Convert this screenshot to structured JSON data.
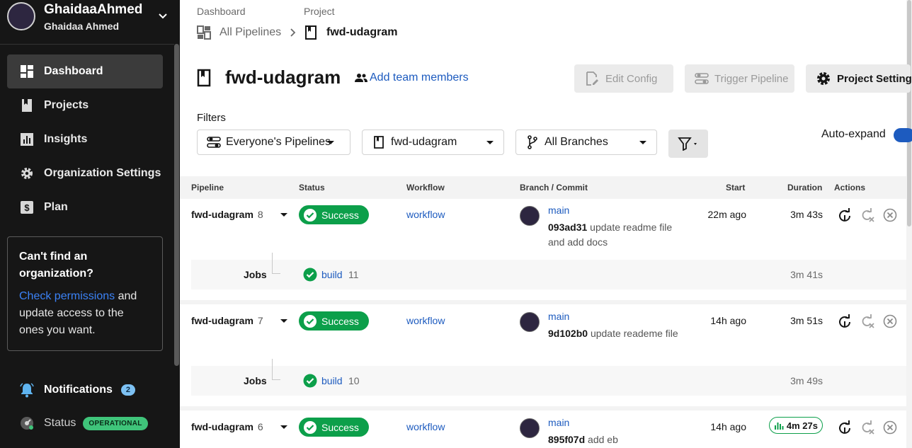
{
  "org": {
    "name": "GhaidaaAhmed",
    "user": "Ghaidaa Ahmed"
  },
  "nav": {
    "items": [
      {
        "label": "Dashboard",
        "icon": "dashboard-icon",
        "active": true
      },
      {
        "label": "Projects",
        "icon": "bookmark-icon",
        "active": false
      },
      {
        "label": "Insights",
        "icon": "bar-chart-icon",
        "active": false
      },
      {
        "label": "Organization Settings",
        "icon": "gear-icon",
        "active": false
      },
      {
        "label": "Plan",
        "icon": "dollar-icon",
        "active": false
      }
    ]
  },
  "card": {
    "heading": "Can't find an organization?",
    "link": "Check permissions",
    "text": " and update access to the ones you want."
  },
  "notifications": {
    "label": "Notifications",
    "count": "2"
  },
  "status": {
    "label": "Status",
    "badge": "OPERATIONAL"
  },
  "breadcrumb": {
    "dashboard_label": "Dashboard",
    "project_label": "Project",
    "pipelines": "All Pipelines",
    "project": "fwd-udagram"
  },
  "header": {
    "title": "fwd-udagram",
    "add_team": "Add team members",
    "edit_config": "Edit Config",
    "trigger": "Trigger Pipeline",
    "settings": "Project Settings"
  },
  "filters": {
    "label": "Filters",
    "everyone": "Everyone's Pipelines",
    "project": "fwd-udagram",
    "branches": "All Branches",
    "auto_expand": "Auto-expand"
  },
  "table": {
    "columns": {
      "pipeline": "Pipeline",
      "status": "Status",
      "workflow": "Workflow",
      "branch": "Branch / Commit",
      "start": "Start",
      "duration": "Duration",
      "actions": "Actions"
    },
    "rows": [
      {
        "name": "fwd-udagram",
        "number": "8",
        "status": "Success",
        "workflow": "workflow",
        "branch": "main",
        "hash": "093ad31",
        "message": "update readme file and add docs",
        "start": "22m ago",
        "duration": "3m 43s",
        "jobs_label": "Jobs",
        "job": "build",
        "job_number": "11",
        "job_duration": "3m 41s"
      },
      {
        "name": "fwd-udagram",
        "number": "7",
        "status": "Success",
        "workflow": "workflow",
        "branch": "main",
        "hash": "9d102b0",
        "message": "update reademe file",
        "start": "14h ago",
        "duration": "3m 51s",
        "jobs_label": "Jobs",
        "job": "build",
        "job_number": "10",
        "job_duration": "3m 49s"
      },
      {
        "name": "fwd-udagram",
        "number": "6",
        "status": "Success",
        "workflow": "workflow",
        "branch": "main",
        "hash": "895f07d",
        "message": "add eb",
        "start": "14h ago",
        "duration": "4m 27s"
      }
    ]
  },
  "colors": {
    "success": "#0c9f4a",
    "link": "#1d5bbf",
    "sidebar": "#161616"
  }
}
